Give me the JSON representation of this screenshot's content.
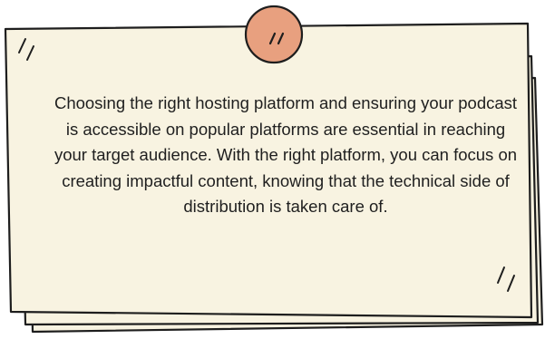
{
  "note": {
    "body": "Choosing the right hosting platform and ensuring your podcast is accessible on popular platforms are essential in reaching your target audience. With the right platform, you can focus on creating impactful content, knowing that the technical side of distribution is taken care of."
  },
  "colors": {
    "paper": "#f8f3e1",
    "outline": "#1e1e1e",
    "pin": "#e8a07f"
  },
  "icons": {
    "pin": "pushpin-icon",
    "marks": "double-slash-mark"
  }
}
